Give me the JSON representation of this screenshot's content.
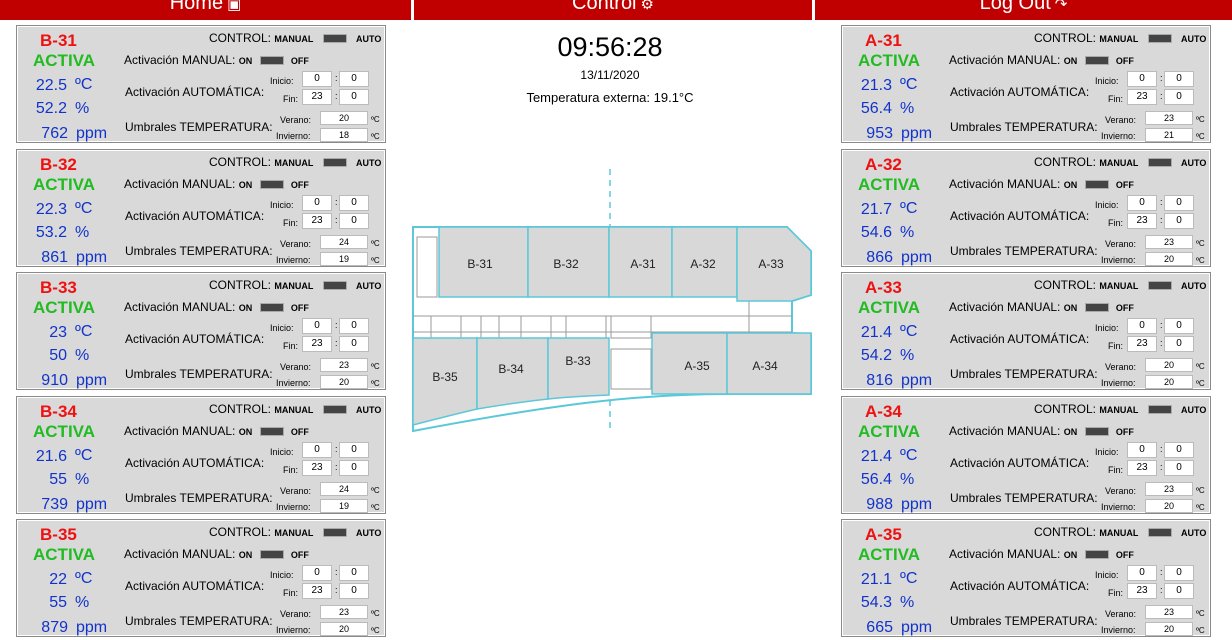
{
  "nav": {
    "home": "Home",
    "control": "Control",
    "logout": "Log Out",
    "home_icon": "home-icon",
    "control_icon": "gear-icon",
    "logout_icon": "logout-icon"
  },
  "labels": {
    "control": "CONTROL:",
    "manual": "MANUAL",
    "auto": "AUTO",
    "manual_act": "Activación MANUAL:",
    "on": "ON",
    "off": "OFF",
    "auto_act": "Activación AUTOMÁTICA:",
    "inicio": "Inicio:",
    "fin": "Fin:",
    "umbrales": "Umbrales TEMPERATURA:",
    "verano": "Verano:",
    "invierno": "Invierno:",
    "deg": "ºC",
    "temp_unit": "ºC",
    "hum_unit": "%",
    "co2_unit": "ppm",
    "colon": ":"
  },
  "header": {
    "clock": "09:56:28",
    "date": "13/11/2020",
    "temp_ext": "Temperatura externa: 19.1°C"
  },
  "rooms_left": [
    {
      "id": "B-31",
      "state": "ACTIVA",
      "temp": "22.5",
      "hum": "52.2",
      "co2": "762",
      "ini_h": "0",
      "ini_m": "0",
      "fin_h": "23",
      "fin_m": "0",
      "verano": "20",
      "invierno": "18"
    },
    {
      "id": "B-32",
      "state": "ACTIVA",
      "temp": "22.3",
      "hum": "53.2",
      "co2": "861",
      "ini_h": "0",
      "ini_m": "0",
      "fin_h": "23",
      "fin_m": "0",
      "verano": "24",
      "invierno": "19"
    },
    {
      "id": "B-33",
      "state": "ACTIVA",
      "temp": "23",
      "hum": "50",
      "co2": "910",
      "ini_h": "0",
      "ini_m": "0",
      "fin_h": "23",
      "fin_m": "0",
      "verano": "23",
      "invierno": "20"
    },
    {
      "id": "B-34",
      "state": "ACTIVA",
      "temp": "21.6",
      "hum": "55",
      "co2": "739",
      "ini_h": "0",
      "ini_m": "0",
      "fin_h": "23",
      "fin_m": "0",
      "verano": "24",
      "invierno": "19"
    },
    {
      "id": "B-35",
      "state": "ACTIVA",
      "temp": "22",
      "hum": "55",
      "co2": "879",
      "ini_h": "0",
      "ini_m": "0",
      "fin_h": "23",
      "fin_m": "0",
      "verano": "23",
      "invierno": "20"
    }
  ],
  "rooms_right": [
    {
      "id": "A-31",
      "state": "ACTIVA",
      "temp": "21.3",
      "hum": "56.4",
      "co2": "953",
      "ini_h": "0",
      "ini_m": "0",
      "fin_h": "23",
      "fin_m": "0",
      "verano": "23",
      "invierno": "21"
    },
    {
      "id": "A-32",
      "state": "ACTIVA",
      "temp": "21.7",
      "hum": "54.6",
      "co2": "866",
      "ini_h": "0",
      "ini_m": "0",
      "fin_h": "23",
      "fin_m": "0",
      "verano": "23",
      "invierno": "20"
    },
    {
      "id": "A-33",
      "state": "ACTIVA",
      "temp": "21.4",
      "hum": "54.2",
      "co2": "816",
      "ini_h": "0",
      "ini_m": "0",
      "fin_h": "23",
      "fin_m": "0",
      "verano": "20",
      "invierno": "20"
    },
    {
      "id": "A-34",
      "state": "ACTIVA",
      "temp": "21.4",
      "hum": "56.4",
      "co2": "988",
      "ini_h": "0",
      "ini_m": "0",
      "fin_h": "23",
      "fin_m": "0",
      "verano": "23",
      "invierno": "20"
    },
    {
      "id": "A-35",
      "state": "ACTIVA",
      "temp": "21.1",
      "hum": "54.3",
      "co2": "665",
      "ini_h": "0",
      "ini_m": "0",
      "fin_h": "23",
      "fin_m": "0",
      "verano": "23",
      "invierno": "20"
    }
  ],
  "floorplan": {
    "rooms": [
      "B-31",
      "B-32",
      "A-31",
      "A-32",
      "A-33",
      "B-35",
      "B-34",
      "B-33",
      "A-35",
      "A-34"
    ]
  },
  "colors": {
    "nav_bg": "#c00000",
    "room_id": "#ee1111",
    "state_active": "#22bb22",
    "measure": "#1133cc",
    "plan_stroke": "#5bc8d8",
    "room_fill": "#d8d8d8"
  }
}
